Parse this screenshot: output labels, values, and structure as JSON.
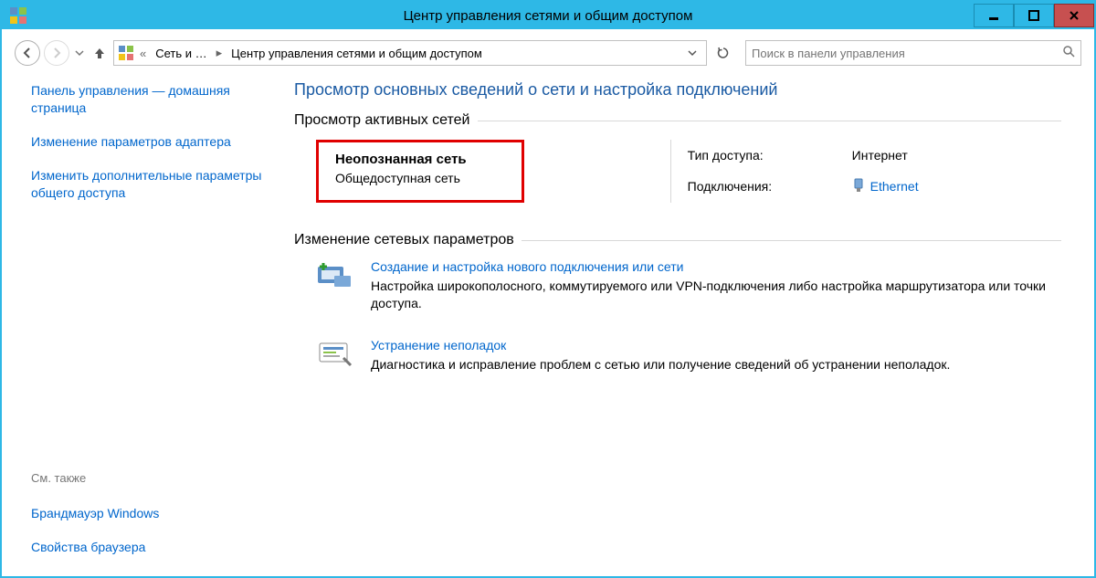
{
  "window": {
    "title": "Центр управления сетями и общим доступом"
  },
  "breadcrumb": {
    "seg1": "Сеть и …",
    "seg2": "Центр управления сетями и общим доступом"
  },
  "search": {
    "placeholder": "Поиск в панели управления"
  },
  "sidebar": {
    "home": "Панель управления — домашняя страница",
    "adapter": "Изменение параметров адаптера",
    "sharing": "Изменить дополнительные параметры общего доступа",
    "see_also_label": "См. также",
    "firewall": "Брандмауэр Windows",
    "browser": "Свойства браузера"
  },
  "content": {
    "heading": "Просмотр основных сведений о сети и настройка подключений",
    "active_label": "Просмотр активных сетей",
    "network": {
      "name": "Неопознанная сеть",
      "type": "Общедоступная сеть",
      "access_label": "Тип доступа:",
      "access_value": "Интернет",
      "conn_label": "Подключения:",
      "conn_value": "Ethernet"
    },
    "change_label": "Изменение сетевых параметров",
    "action1": {
      "title": "Создание и настройка нового подключения или сети",
      "desc": "Настройка широкополосного, коммутируемого или VPN-подключения либо настройка маршрутизатора или точки доступа."
    },
    "action2": {
      "title": "Устранение неполадок",
      "desc": "Диагностика и исправление проблем с сетью или получение сведений об устранении неполадок."
    }
  }
}
